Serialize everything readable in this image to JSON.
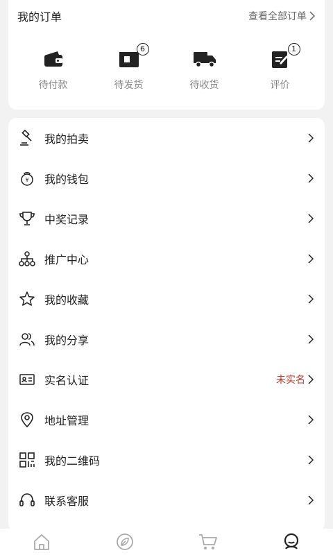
{
  "orders": {
    "title": "我的订单",
    "view_all": "查看全部订单",
    "items": [
      {
        "label": "待付款",
        "icon": "wallet-icon"
      },
      {
        "label": "待发货",
        "icon": "package-icon",
        "badge": "6"
      },
      {
        "label": "待收货",
        "icon": "truck-icon"
      },
      {
        "label": "评价",
        "icon": "review-icon",
        "badge": "1"
      }
    ]
  },
  "menu": {
    "items": [
      {
        "label": "我的拍卖",
        "icon": "gavel-icon"
      },
      {
        "label": "我的钱包",
        "icon": "money-bag-icon"
      },
      {
        "label": "中奖记录",
        "icon": "trophy-icon"
      },
      {
        "label": "推广中心",
        "icon": "network-icon"
      },
      {
        "label": "我的收藏",
        "icon": "star-icon"
      },
      {
        "label": "我的分享",
        "icon": "share-users-icon"
      },
      {
        "label": "实名认证",
        "icon": "id-card-icon",
        "extra": "未实名"
      },
      {
        "label": "地址管理",
        "icon": "location-pin-icon"
      },
      {
        "label": "我的二维码",
        "icon": "qr-code-icon"
      },
      {
        "label": "联系客服",
        "icon": "headset-icon"
      }
    ]
  },
  "tabbar": {
    "tabs": [
      {
        "icon": "home-icon"
      },
      {
        "icon": "leaf-icon"
      },
      {
        "icon": "cart-icon"
      },
      {
        "icon": "profile-icon",
        "active": true
      }
    ]
  },
  "colors": {
    "background": "#f2f2f2",
    "card": "#ffffff",
    "text": "#222222",
    "muted": "#888888",
    "warning": "#c0392b"
  }
}
